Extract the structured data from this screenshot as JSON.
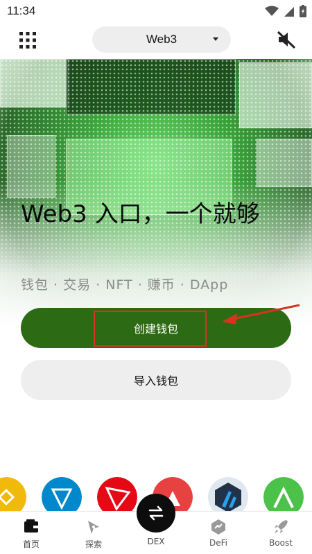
{
  "status_bar": {
    "time": "11:34"
  },
  "top_bar": {
    "network_selector": "Web3"
  },
  "hero": {
    "headline": "Web3 入口，一个就够",
    "tagline": "钱包 · 交易 · NFT · 赚币 · DApp"
  },
  "actions": {
    "create_wallet": "创建钱包",
    "import_wallet": "导入钱包"
  },
  "tokens": [
    "bnb",
    "ton",
    "tron",
    "avalanche",
    "arbitrum",
    "aptos"
  ],
  "bottom_nav": {
    "items": [
      {
        "label": "首页",
        "icon": "wallet-icon"
      },
      {
        "label": "探索",
        "icon": "compass-icon"
      },
      {
        "label": "DEX",
        "icon": "swap-icon"
      },
      {
        "label": "DeFi",
        "icon": "defi-icon"
      },
      {
        "label": "Boost",
        "icon": "rocket-icon"
      }
    ]
  },
  "colors": {
    "primary_green": "#2d6a14",
    "annotation_red": "#d8331e"
  }
}
